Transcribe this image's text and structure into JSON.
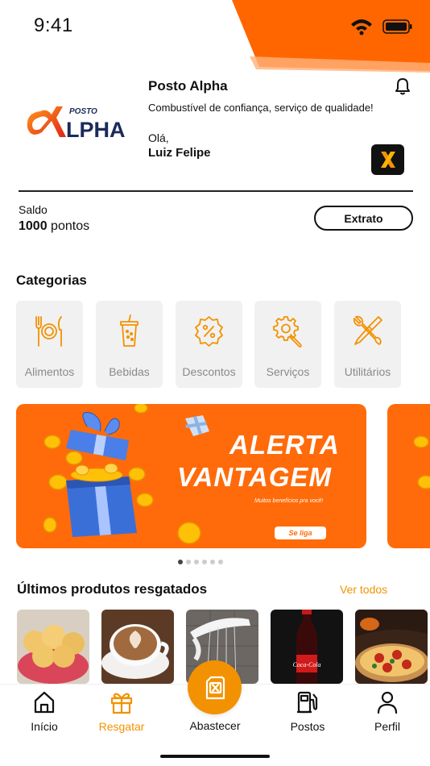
{
  "status_bar": {
    "time": "9:41"
  },
  "header": {
    "logo_small_text": "POSTO",
    "logo_big_text": "LPHA",
    "title": "Posto Alpha",
    "tagline": "Combustível de confiança, serviço de qualidade!",
    "greeting": "Olá,",
    "user_name": "Luiz Felipe"
  },
  "balance": {
    "label": "Saldo",
    "value": "1000",
    "unit": "pontos",
    "statement_button": "Extrato"
  },
  "categories": {
    "title": "Categorias",
    "items": [
      {
        "label": "Alimentos",
        "icon": "utensils-icon"
      },
      {
        "label": "Bebidas",
        "icon": "drink-cup-icon"
      },
      {
        "label": "Descontos",
        "icon": "discount-badge-icon"
      },
      {
        "label": "Serviços",
        "icon": "gear-wrench-icon"
      },
      {
        "label": "Utilitários",
        "icon": "tools-icon"
      }
    ]
  },
  "banner": {
    "line1": "ALERTA",
    "line2": "VANTAGEM",
    "subtitle": "Muitos benefícios pra você!",
    "cta": "Se liga",
    "pages": 6,
    "active_page": 1
  },
  "products": {
    "title": "Últimos produtos resgatados",
    "see_all": "Ver todos",
    "items": [
      "pão de queijo",
      "café",
      "chuveiro",
      "coca-cola",
      "pizza"
    ]
  },
  "bottom_nav": {
    "items": [
      {
        "label": "Início",
        "icon": "home-icon"
      },
      {
        "label": "Resgatar",
        "icon": "gift-icon",
        "active": true
      },
      {
        "label": "Abastecer",
        "icon": "fuel-can-icon"
      },
      {
        "label": "Postos",
        "icon": "gas-pump-icon"
      },
      {
        "label": "Perfil",
        "icon": "user-icon"
      }
    ]
  },
  "colors": {
    "accent": "#f39200",
    "banner": "#ff6b0a"
  }
}
